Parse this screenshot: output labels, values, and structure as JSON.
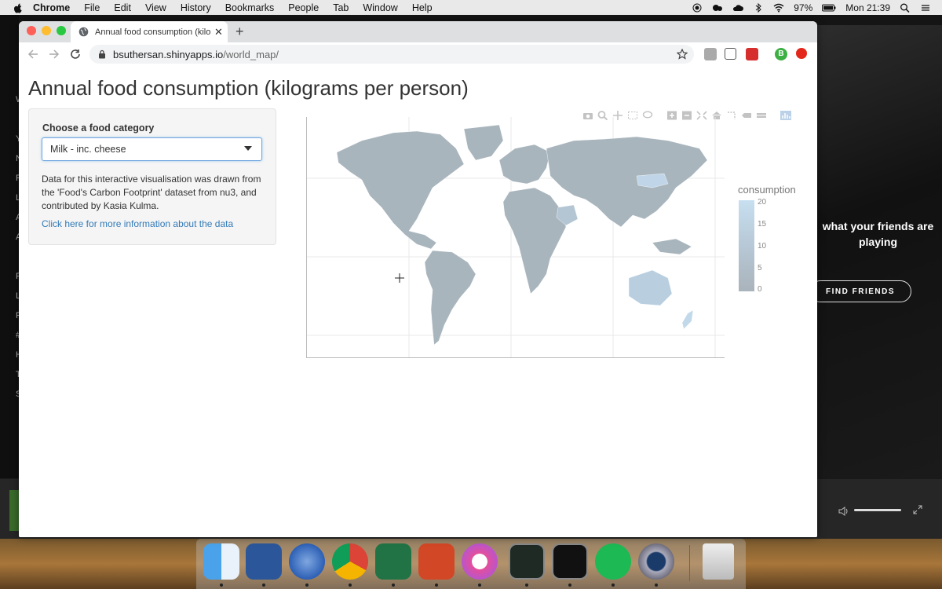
{
  "menubar": {
    "app_name": "Chrome",
    "items": [
      "File",
      "Edit",
      "View",
      "History",
      "Bookmarks",
      "People",
      "Tab",
      "Window",
      "Help"
    ],
    "battery": "97%",
    "clock": "Mon 21:39"
  },
  "browser": {
    "tab_title": "Annual food consumption (kilo",
    "url_host": "bsuthersan.shinyapps.io",
    "url_path": "/world_map/",
    "profile_initial": "B"
  },
  "page": {
    "title": "Annual food consumption (kilograms per person)",
    "panel": {
      "label": "Choose a food category",
      "selected": "Milk - inc. cheese",
      "description": "Data for this interactive visualisation was drawn from the 'Food's Carbon Footprint' dataset from nu3, and contributed by Kasia Kulma.",
      "link": "Click here for more information about the data"
    },
    "map": {
      "colorbar_title": "consumption",
      "colorbar_ticks": [
        "20",
        "15",
        "10",
        "5",
        "0"
      ],
      "colors": {
        "low": "#a9b3bb",
        "high": "#c7dff0",
        "land": "#a9b5bd"
      }
    }
  },
  "background_app": {
    "friends_text": "what your friends are playing",
    "find_button": "FIND FRIENDS",
    "sidebar_letters": [
      "W",
      "",
      "Y",
      "N",
      "F",
      "L",
      "A",
      "A",
      "",
      "P",
      "L",
      "F",
      "#",
      "H",
      "T",
      "S"
    ]
  }
}
